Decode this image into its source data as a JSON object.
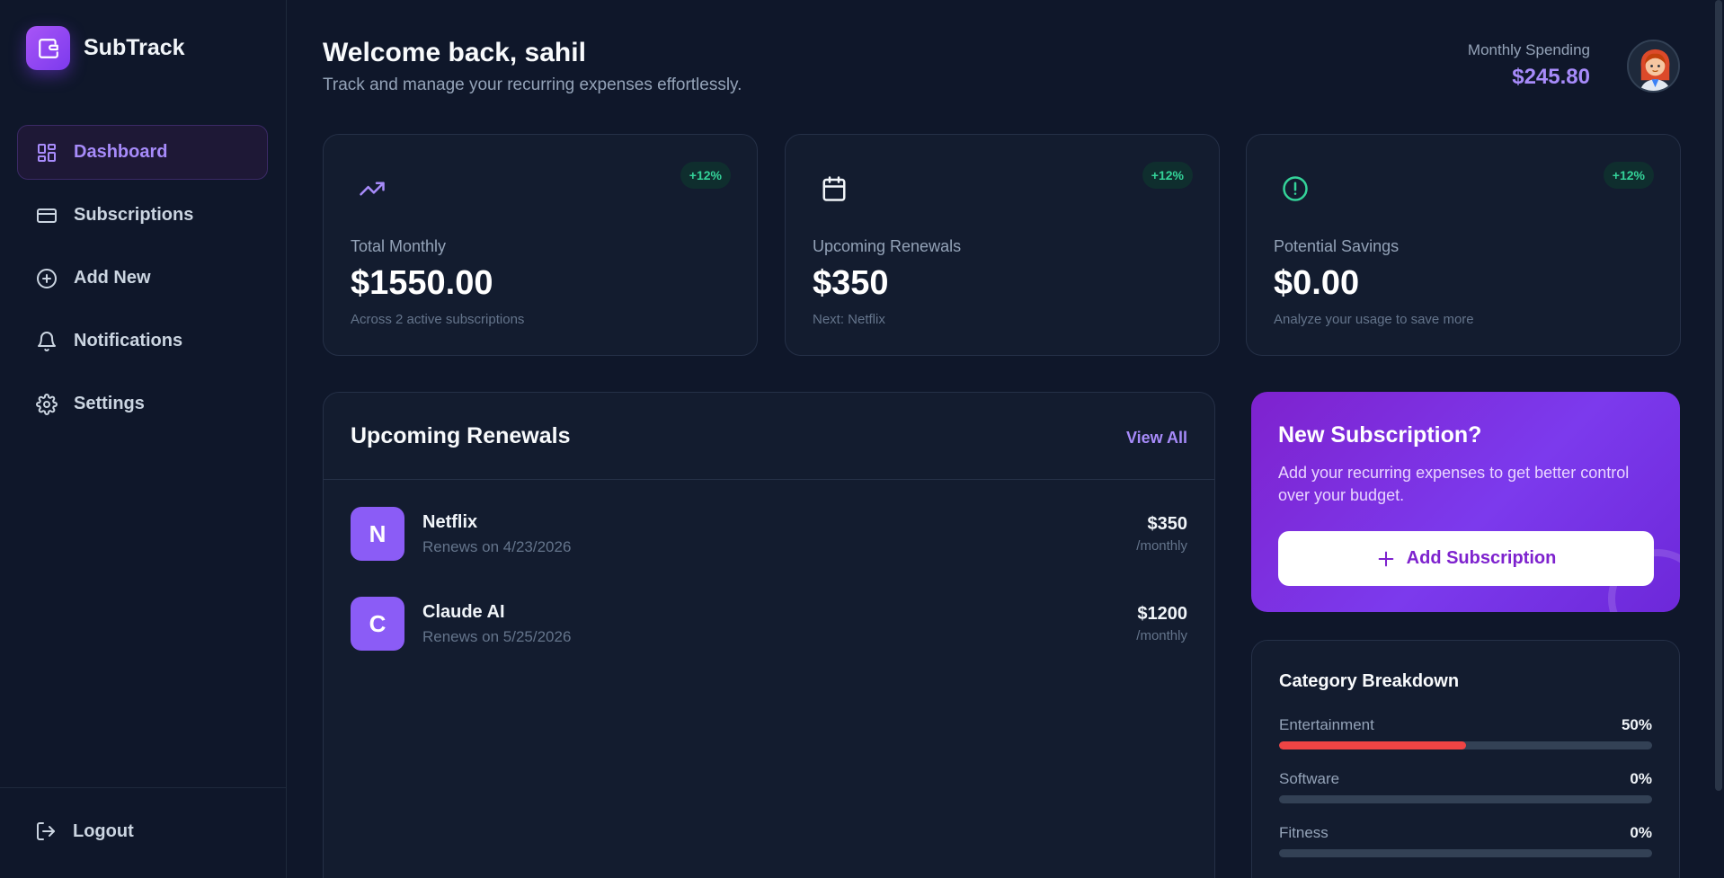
{
  "brand": {
    "name": "SubTrack"
  },
  "nav": {
    "items": [
      {
        "label": "Dashboard",
        "icon": "dashboard-icon",
        "active": true
      },
      {
        "label": "Subscriptions",
        "icon": "credit-card-icon"
      },
      {
        "label": "Add New",
        "icon": "plus-circle-icon"
      },
      {
        "label": "Notifications",
        "icon": "bell-icon"
      },
      {
        "label": "Settings",
        "icon": "gear-icon"
      }
    ],
    "logout": "Logout"
  },
  "header": {
    "title": "Welcome back, sahil",
    "subtitle": "Track and manage your recurring expenses effortlessly.",
    "spending_label": "Monthly Spending",
    "spending_value": "$245.80"
  },
  "stats": [
    {
      "label": "Total Monthly",
      "value": "$1550.00",
      "sub": "Across 2 active subscriptions",
      "badge": "+12%",
      "icon": "trending-up-icon",
      "icon_color": "#a78bfa"
    },
    {
      "label": "Upcoming Renewals",
      "value": "$350",
      "sub": "Next: Netflix",
      "badge": "+12%",
      "icon": "calendar-icon",
      "icon_color": "#f1f5f9"
    },
    {
      "label": "Potential Savings",
      "value": "$0.00",
      "sub": "Analyze your usage to save more",
      "badge": "+12%",
      "icon": "alert-circle-icon",
      "icon_color": "#34d399"
    }
  ],
  "renewals": {
    "title": "Upcoming Renewals",
    "view_all": "View All",
    "items": [
      {
        "initial": "N",
        "name": "Netflix",
        "date": "Renews on 4/23/2026",
        "price": "$350",
        "period": "/monthly"
      },
      {
        "initial": "C",
        "name": "Claude AI",
        "date": "Renews on 5/25/2026",
        "price": "$1200",
        "period": "/monthly"
      }
    ]
  },
  "promo": {
    "title": "New Subscription?",
    "text": "Add your recurring expenses to get better control over your budget.",
    "button": "Add Subscription"
  },
  "category": {
    "title": "Category Breakdown",
    "items": [
      {
        "name": "Entertainment",
        "pct": "50%",
        "fraction": 0.5
      },
      {
        "name": "Software",
        "pct": "0%",
        "fraction": 0
      },
      {
        "name": "Fitness",
        "pct": "0%",
        "fraction": 0
      }
    ]
  },
  "colors": {
    "accent": "#8b5cf6",
    "badge": "#34d399",
    "bar_fill": "#ef4444"
  }
}
